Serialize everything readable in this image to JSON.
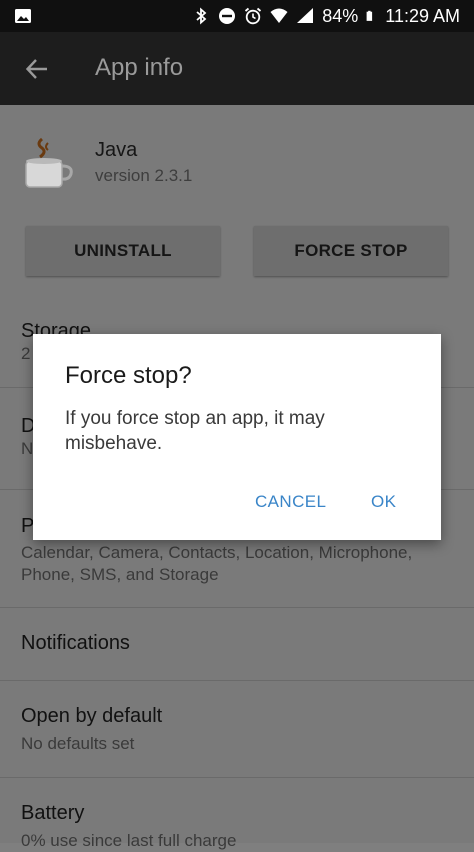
{
  "status_bar": {
    "battery": "84%",
    "time": "11:29 AM"
  },
  "toolbar": {
    "title": "App info"
  },
  "app": {
    "name": "Java",
    "version": "version 2.3.1"
  },
  "buttons": {
    "uninstall": "UNINSTALL",
    "force_stop": "FORCE STOP"
  },
  "rows": {
    "storage": {
      "title": "Storage",
      "subtitle_fragment": "2"
    },
    "data": {
      "title_fragment": "D",
      "subtitle_fragment": "N"
    },
    "permissions": {
      "title_fragment": "P",
      "subtitle": "Calendar, Camera, Contacts, Location, Microphone, Phone, SMS, and Storage"
    },
    "notifications": {
      "title": "Notifications"
    },
    "open_by_default": {
      "title": "Open by default",
      "subtitle": "No defaults set"
    },
    "battery": {
      "title": "Battery",
      "subtitle": "0% use since last full charge"
    }
  },
  "dialog": {
    "title": "Force stop?",
    "message": "If you force stop an app, it may misbehave.",
    "cancel": "CANCEL",
    "ok": "OK"
  }
}
